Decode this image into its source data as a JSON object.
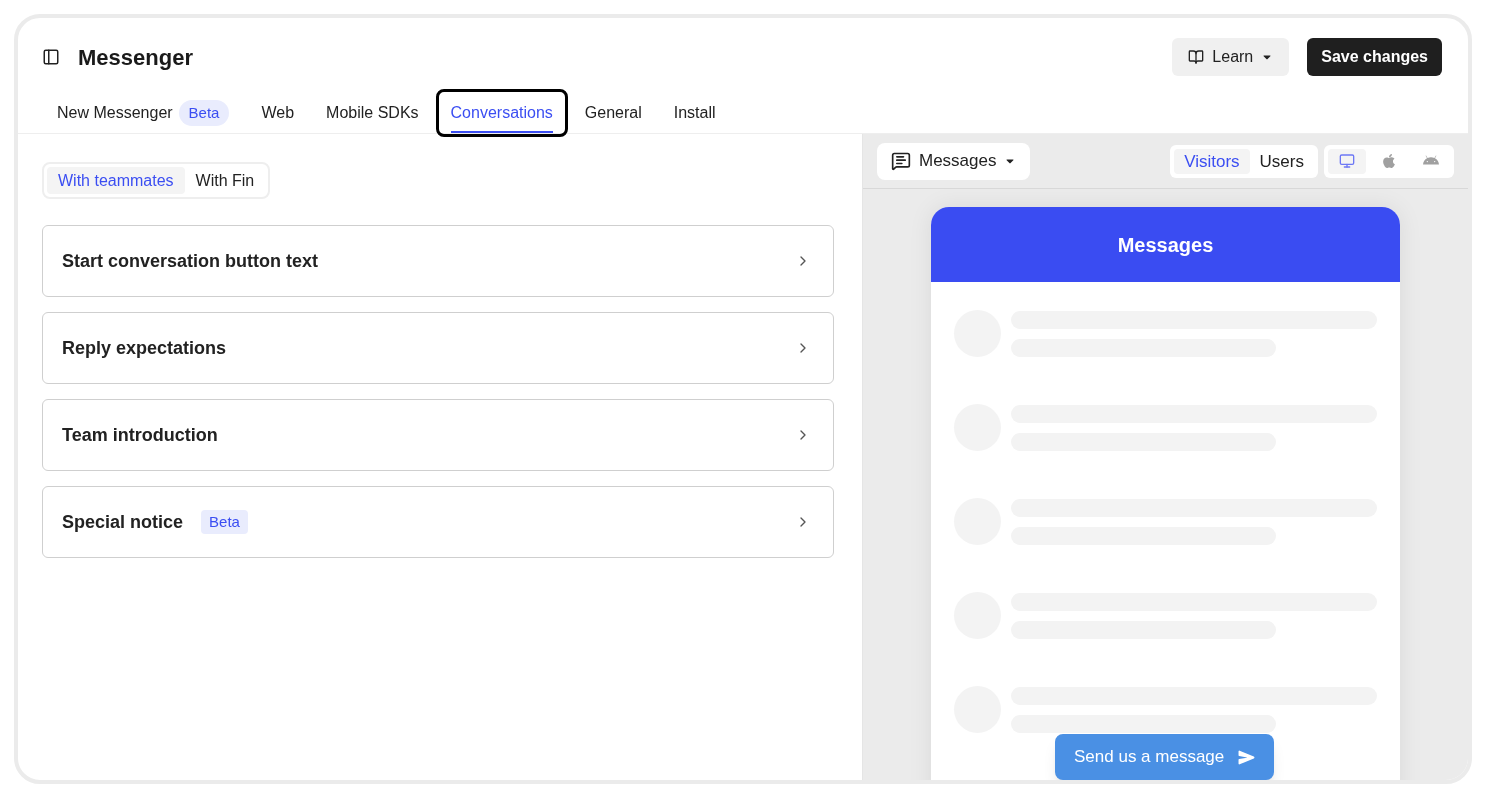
{
  "header": {
    "title": "Messenger",
    "learn_button": "Learn",
    "save_button": "Save changes"
  },
  "tabs": [
    {
      "label": "New Messenger",
      "badge": "Beta",
      "selected": false
    },
    {
      "label": "Web",
      "selected": false
    },
    {
      "label": "Mobile SDKs",
      "selected": false
    },
    {
      "label": "Conversations",
      "selected": true
    },
    {
      "label": "General",
      "selected": false
    },
    {
      "label": "Install",
      "selected": false
    }
  ],
  "segment": [
    {
      "label": "With teammates",
      "selected": true
    },
    {
      "label": "With Fin",
      "selected": false
    }
  ],
  "settings": [
    {
      "label": "Start conversation button text"
    },
    {
      "label": "Reply expectations"
    },
    {
      "label": "Team introduction"
    },
    {
      "label": "Special notice",
      "badge": "Beta"
    }
  ],
  "preview": {
    "dropdown": "Messages",
    "audience": [
      {
        "label": "Visitors",
        "selected": true
      },
      {
        "label": "Users",
        "selected": false
      }
    ],
    "devices": [
      {
        "kind": "desktop",
        "selected": true
      },
      {
        "kind": "apple",
        "selected": false
      },
      {
        "kind": "android",
        "selected": false
      }
    ],
    "messenger": {
      "title": "Messages",
      "send_button": "Send us a message"
    }
  }
}
